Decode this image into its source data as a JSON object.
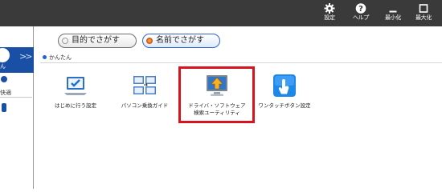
{
  "window_controls": [
    {
      "label": "設定",
      "icon": "gear-icon"
    },
    {
      "label": "ヘルプ",
      "icon": "help-icon"
    },
    {
      "label": "最小化",
      "icon": "minimize-icon"
    },
    {
      "label": "最大化",
      "icon": "maximize-icon"
    }
  ],
  "sidebar": {
    "active_label": "ん",
    "chevron": ">>",
    "item2_label": "快適"
  },
  "tabs": [
    {
      "label": "目的でさがす",
      "selected": false
    },
    {
      "label": "名前でさがす",
      "selected": true
    }
  ],
  "section": {
    "label": "かんたん"
  },
  "apps": [
    {
      "label": "はじめに行う設定",
      "icon": "laptop-check-icon"
    },
    {
      "label": "パソコン乗換ガイド",
      "icon": "pc-transfer-icon"
    },
    {
      "label": "ドライバ・ソフトウェア",
      "label2": "検索ユーティリティ",
      "icon": "driver-search-icon"
    },
    {
      "label": "ワンタッチボタン設定",
      "icon": "one-touch-button-icon"
    }
  ],
  "colors": {
    "topbar": "#3a3a3a",
    "sidebar_active": "#1a4fa6",
    "highlight": "#d6141e",
    "tab_active_border": "#2e66c8"
  }
}
